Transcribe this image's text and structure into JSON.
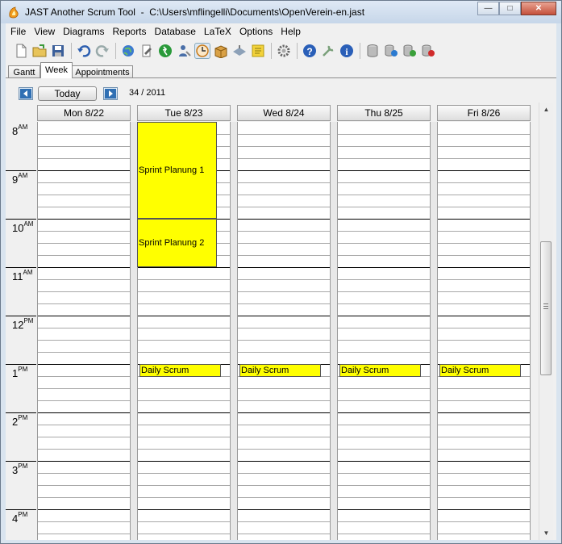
{
  "window": {
    "title": "JAST Another Scrum Tool  -  C:\\Users\\mflingelli\\Documents\\OpenVerein-en.jast",
    "minimize_label": "—",
    "maximize_label": "□",
    "close_label": "✕"
  },
  "menu": [
    "File",
    "View",
    "Diagrams",
    "Reports",
    "Database",
    "LaTeX",
    "Options",
    "Help"
  ],
  "toolbar": {
    "icons": [
      "new-file-icon",
      "open-folder-icon",
      "save-icon",
      "undo-icon",
      "redo-icon",
      "globe-icon",
      "document-edit-icon",
      "green-run-icon",
      "user-tool-icon",
      "clock-icon",
      "package-icon",
      "network-icon",
      "sticky-note-icon",
      "gear-icon",
      "help-icon",
      "tool-icon",
      "info-icon",
      "database-icon",
      "database-globe-icon",
      "database-export-icon",
      "database-delete-icon"
    ]
  },
  "tabs": [
    {
      "label": "Gantt",
      "active": false
    },
    {
      "label": "Week",
      "active": true
    },
    {
      "label": "Appointments",
      "active": false
    }
  ],
  "nav": {
    "today_label": "Today",
    "week_label": "34 / 2011"
  },
  "days": [
    "Mon 8/22",
    "Tue 8/23",
    "Wed 8/24",
    "Thu 8/25",
    "Fri 8/26"
  ],
  "hours": [
    {
      "num": "8",
      "ampm": "AM"
    },
    {
      "num": "9",
      "ampm": "AM"
    },
    {
      "num": "10",
      "ampm": "AM"
    },
    {
      "num": "11",
      "ampm": "AM"
    },
    {
      "num": "12",
      "ampm": "PM"
    },
    {
      "num": "1",
      "ampm": "PM"
    },
    {
      "num": "2",
      "ampm": "PM"
    },
    {
      "num": "3",
      "ampm": "PM"
    },
    {
      "num": "4",
      "ampm": "PM"
    }
  ],
  "appointments": [
    {
      "day": 1,
      "start": 8,
      "end": 10,
      "title": "Sprint Planung 1"
    },
    {
      "day": 1,
      "start": 10,
      "end": 11,
      "title": "Sprint Planung 2"
    },
    {
      "day": 1,
      "start": 13,
      "end": 13.25,
      "title": "Daily Scrum"
    },
    {
      "day": 2,
      "start": 13,
      "end": 13.25,
      "title": "Daily Scrum"
    },
    {
      "day": 3,
      "start": 13,
      "end": 13.25,
      "title": "Daily Scrum"
    },
    {
      "day": 4,
      "start": 13,
      "end": 13.25,
      "title": "Daily Scrum"
    }
  ],
  "colors": {
    "appointment": "#ffff00",
    "hour_line": "#000000",
    "quarter_line": "#a8a8a8"
  }
}
